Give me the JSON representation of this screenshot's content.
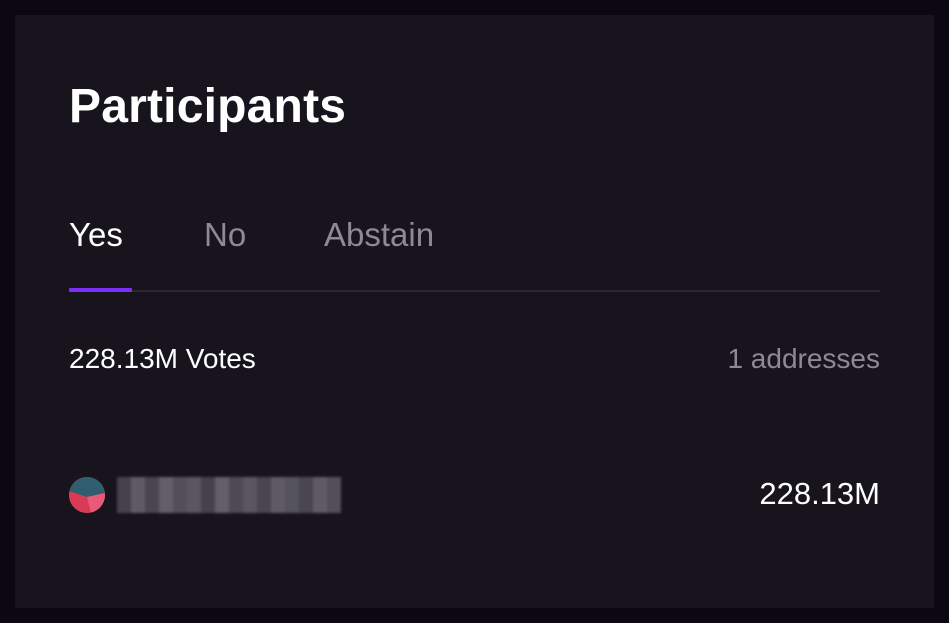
{
  "panel": {
    "title": "Participants"
  },
  "tabs": [
    {
      "label": "Yes",
      "active": true
    },
    {
      "label": "No",
      "active": false
    },
    {
      "label": "Abstain",
      "active": false
    }
  ],
  "summary": {
    "votes": "228.13M Votes",
    "addresses": "1 addresses"
  },
  "participants": [
    {
      "address_redacted": true,
      "value": "228.13M",
      "avatar_icon": "identicon-avatar"
    }
  ],
  "colors": {
    "background": "#17141d",
    "accent": "#7b2ff7",
    "muted_text": "#8d8a94"
  }
}
